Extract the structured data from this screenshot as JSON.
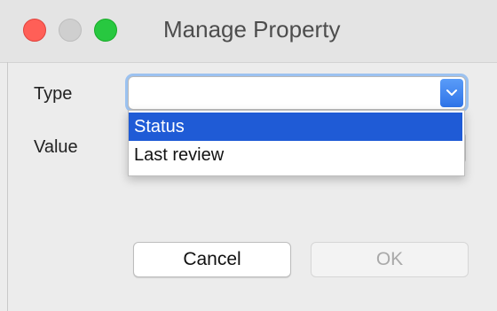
{
  "window": {
    "title": "Manage Property"
  },
  "form": {
    "type_label": "Type",
    "value_label": "Value",
    "type_select": {
      "selected": "",
      "options": [
        "Status",
        "Last review"
      ],
      "highlighted": "Status"
    },
    "value_field": {
      "value": ""
    }
  },
  "buttons": {
    "cancel_label": "Cancel",
    "ok_label": "OK"
  },
  "colors": {
    "close": "#ff5f57",
    "minimize": "#cfcfcf",
    "zoom": "#28c840",
    "selection": "#1f5bd6",
    "focus_ring": "#9cc2f0"
  }
}
